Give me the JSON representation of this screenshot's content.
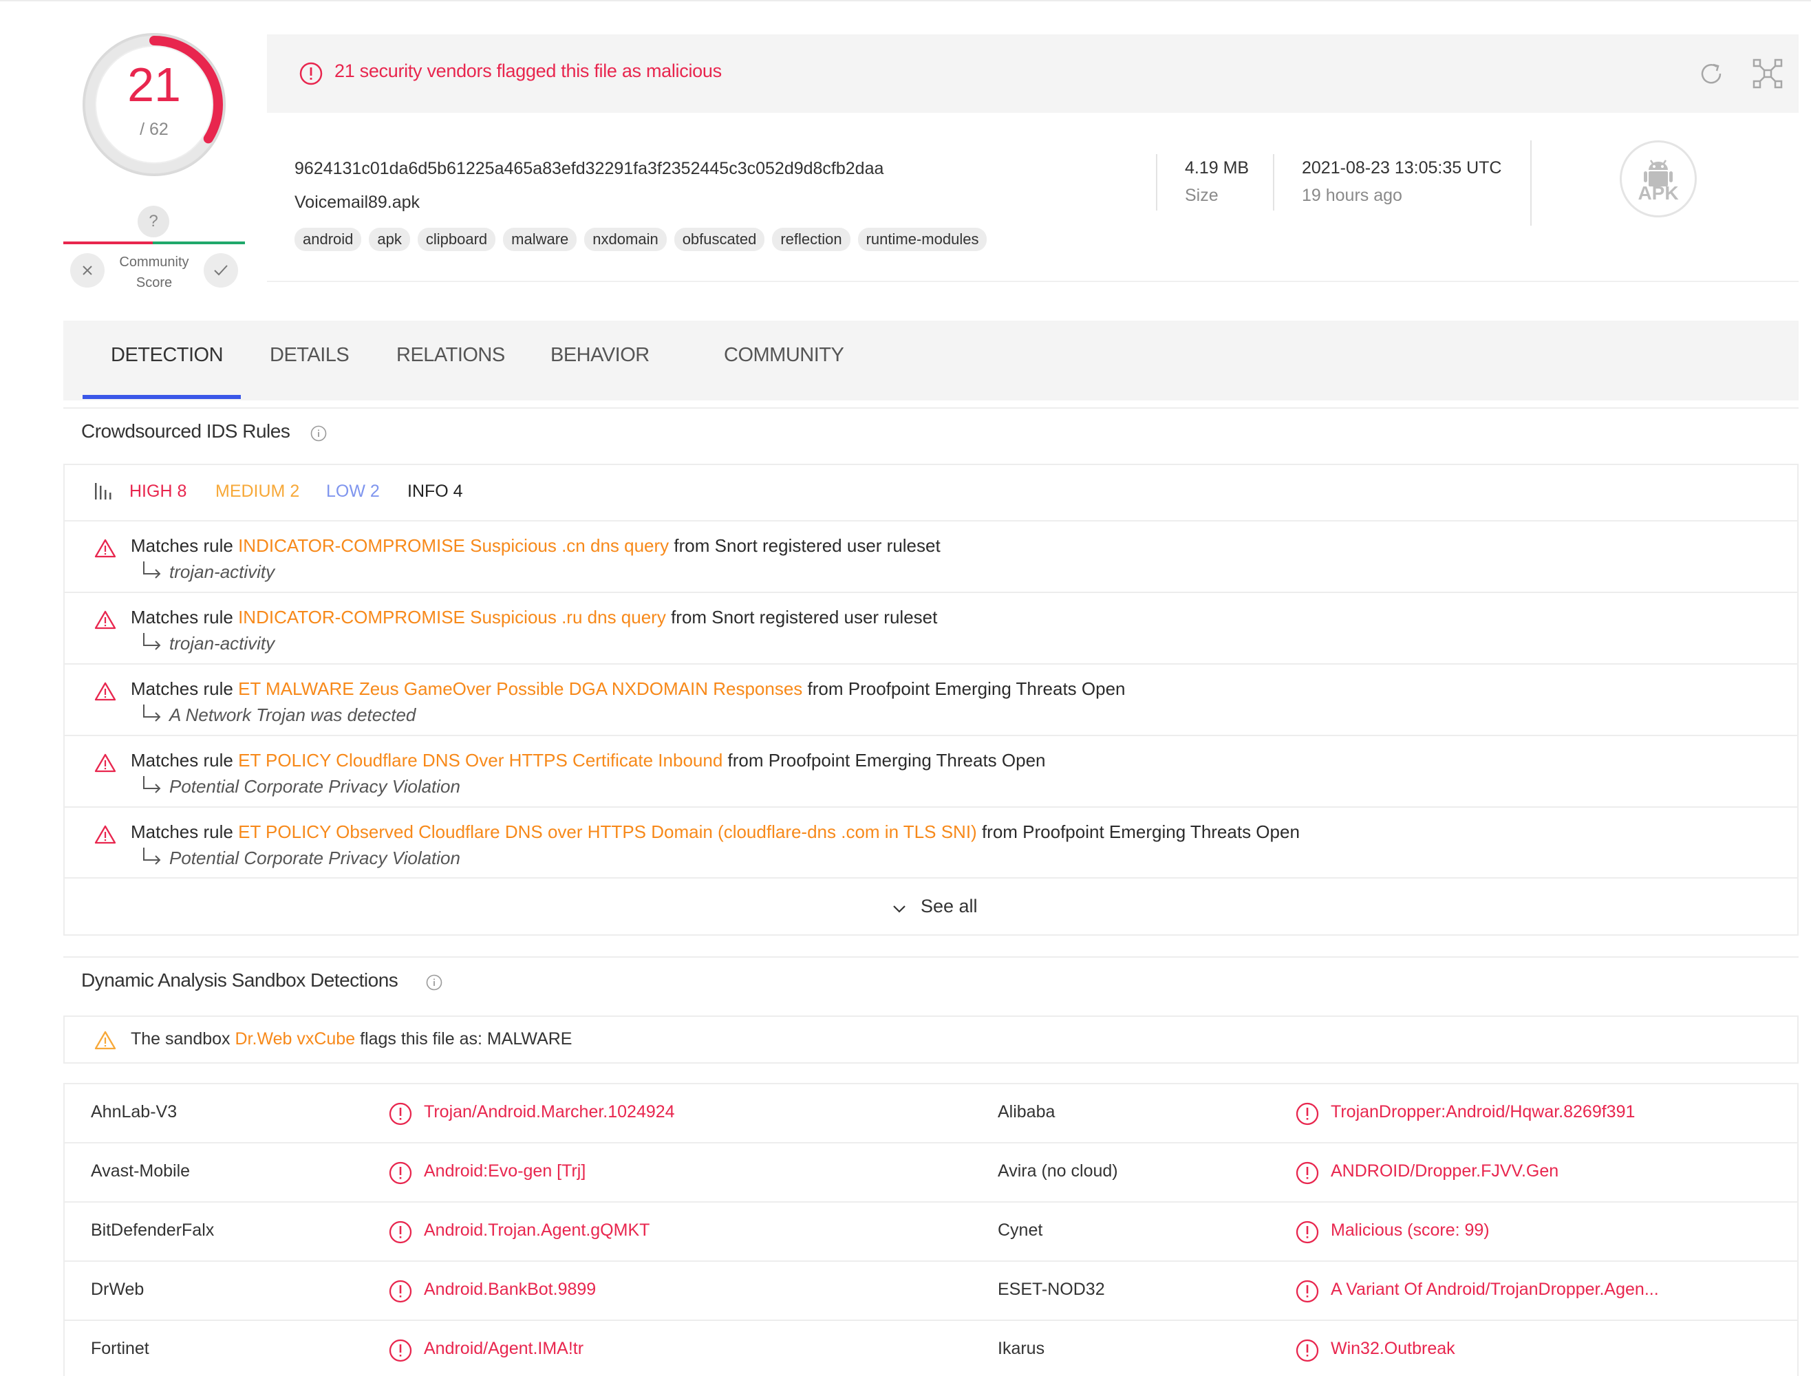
{
  "colors": {
    "malicious_red": "#e8264e",
    "link_orange": "#f7891a",
    "medium_orange": "#f7a838",
    "low_blue": "#7f95ee",
    "tab_accent": "#3a57e8",
    "harmless_green": "#20a86b"
  },
  "score": {
    "detections": "21",
    "total": "/ 62",
    "detection_fraction": 0.339,
    "community_help": "?",
    "community_label_line1": "Community",
    "community_label_line2": "Score",
    "no_icon": "close-icon",
    "yes_icon": "check-icon"
  },
  "header": {
    "alert": "21 security vendors flagged this file as malicious",
    "reload_icon": "reload-icon",
    "graph_icon": "graph-icon"
  },
  "file": {
    "hash": "9624131c01da6d5b61225a465a83efd32291fa3f2352445c3c052d9d8cfb2daa",
    "name": "Voicemail89.apk",
    "tags": [
      "android",
      "apk",
      "clipboard",
      "malware",
      "nxdomain",
      "obfuscated",
      "reflection",
      "runtime-modules"
    ],
    "size_value": "4.19 MB",
    "size_label": "Size",
    "date_value": "2021-08-23 13:05:35 UTC",
    "date_ago": "19 hours ago",
    "type_badge": "APK",
    "type_icon": "android-icon"
  },
  "tabs": [
    "DETECTION",
    "DETAILS",
    "RELATIONS",
    "BEHAVIOR",
    "COMMUNITY"
  ],
  "ids": {
    "title": "Crowdsourced IDS Rules",
    "severity": {
      "high": "HIGH 8",
      "medium": "MEDIUM 2",
      "low": "LOW 2",
      "info": "INFO 4"
    },
    "rules": [
      {
        "prefix": "Matches rule",
        "rule": "INDICATOR-COMPROMISE Suspicious .cn dns query",
        "source": "from Snort registered user ruleset",
        "category": "trojan-activity"
      },
      {
        "prefix": "Matches rule",
        "rule": "INDICATOR-COMPROMISE Suspicious .ru dns query",
        "source": "from Snort registered user ruleset",
        "category": "trojan-activity"
      },
      {
        "prefix": "Matches rule",
        "rule": "ET MALWARE Zeus GameOver Possible DGA NXDOMAIN Responses",
        "source": "from Proofpoint Emerging Threats Open",
        "category": "A Network Trojan was detected"
      },
      {
        "prefix": "Matches rule",
        "rule": "ET POLICY Cloudflare DNS Over HTTPS Certificate Inbound",
        "source": "from Proofpoint Emerging Threats Open",
        "category": "Potential Corporate Privacy Violation"
      },
      {
        "prefix": "Matches rule",
        "rule": "ET POLICY Observed Cloudflare DNS over HTTPS Domain (cloudflare-dns .com in TLS SNI)",
        "source": "from Proofpoint Emerging Threats Open",
        "category": "Potential Corporate Privacy Violation"
      }
    ],
    "see_all": "See all"
  },
  "sandbox": {
    "title": "Dynamic Analysis Sandbox Detections",
    "prefix": "The sandbox",
    "name": "Dr.Web vxCube",
    "suffix": "flags this file as: MALWARE"
  },
  "vendors": [
    {
      "left_name": "AhnLab-V3",
      "left_result": "Trojan/Android.Marcher.1024924",
      "right_name": "Alibaba",
      "right_result": "TrojanDropper:Android/Hqwar.8269f391"
    },
    {
      "left_name": "Avast-Mobile",
      "left_result": "Android:Evo-gen [Trj]",
      "right_name": "Avira (no cloud)",
      "right_result": "ANDROID/Dropper.FJVV.Gen"
    },
    {
      "left_name": "BitDefenderFalx",
      "left_result": "Android.Trojan.Agent.gQMKT",
      "right_name": "Cynet",
      "right_result": "Malicious (score: 99)"
    },
    {
      "left_name": "DrWeb",
      "left_result": "Android.BankBot.9899",
      "right_name": "ESET-NOD32",
      "right_result": "A Variant Of Android/TrojanDropper.Agen..."
    },
    {
      "left_name": "Fortinet",
      "left_result": "Android/Agent.IMA!tr",
      "right_name": "Ikarus",
      "right_result": "Win32.Outbreak"
    }
  ]
}
